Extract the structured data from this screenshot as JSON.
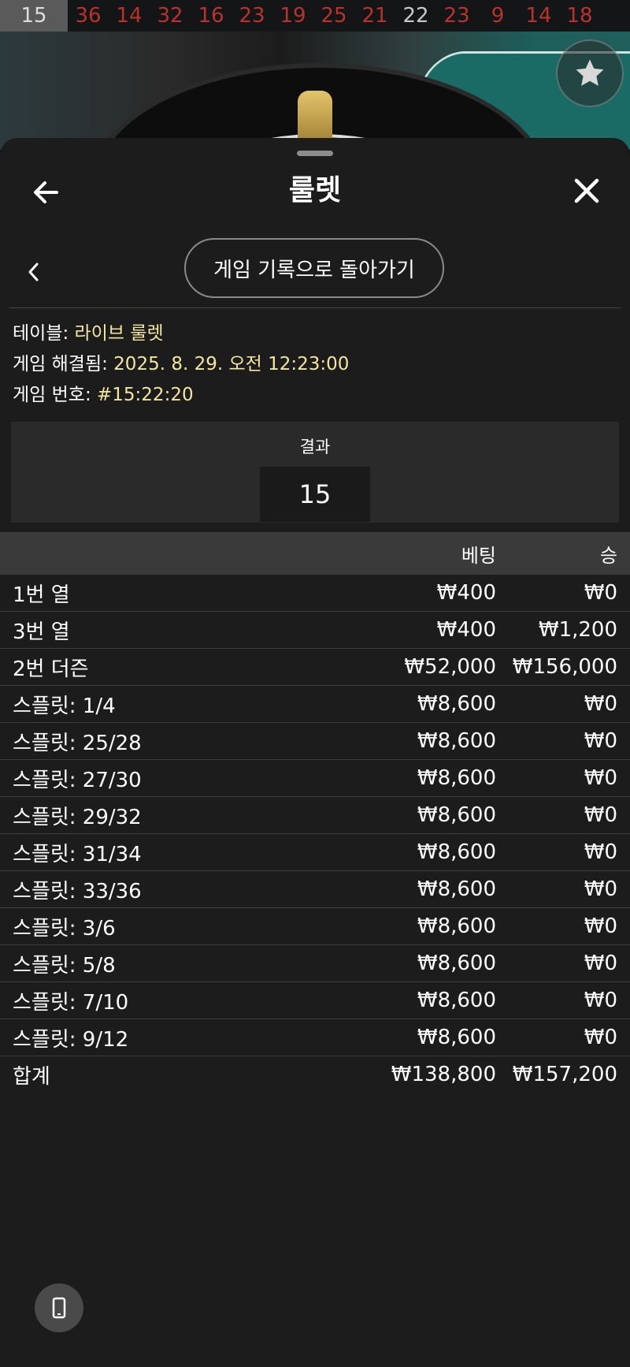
{
  "history": [
    {
      "value": "15",
      "color": "current"
    },
    {
      "value": "36",
      "color": "red"
    },
    {
      "value": "14",
      "color": "red"
    },
    {
      "value": "32",
      "color": "red"
    },
    {
      "value": "16",
      "color": "red"
    },
    {
      "value": "23",
      "color": "red"
    },
    {
      "value": "19",
      "color": "red"
    },
    {
      "value": "25",
      "color": "red"
    },
    {
      "value": "21",
      "color": "red"
    },
    {
      "value": "22",
      "color": "black"
    },
    {
      "value": "23",
      "color": "red"
    },
    {
      "value": "9",
      "color": "red"
    },
    {
      "value": "14",
      "color": "red"
    },
    {
      "value": "18",
      "color": "red"
    }
  ],
  "sheet": {
    "title": "룰렛",
    "back_to_history_label": "게임 기록으로 돌아가기"
  },
  "info": {
    "table_label": "테이블: ",
    "table_value": "라이브 룰렛",
    "resolved_label": "게임 해결됨: ",
    "resolved_value": "2025. 8. 29. 오전 12:23:00",
    "game_no_label": "게임 번호: ",
    "game_no_value": "#15:22:20"
  },
  "result": {
    "label": "결과",
    "value": "15"
  },
  "table": {
    "headers": {
      "bet": "베팅",
      "win": "승"
    },
    "rows": [
      {
        "name": "1번 열",
        "bet": "₩400",
        "win": "₩0"
      },
      {
        "name": "3번 열",
        "bet": "₩400",
        "win": "₩1,200"
      },
      {
        "name": "2번 더즌",
        "bet": "₩52,000",
        "win": "₩156,000"
      },
      {
        "name": "스플릿: 1/4",
        "bet": "₩8,600",
        "win": "₩0"
      },
      {
        "name": "스플릿: 25/28",
        "bet": "₩8,600",
        "win": "₩0"
      },
      {
        "name": "스플릿: 27/30",
        "bet": "₩8,600",
        "win": "₩0"
      },
      {
        "name": "스플릿: 29/32",
        "bet": "₩8,600",
        "win": "₩0"
      },
      {
        "name": "스플릿: 31/34",
        "bet": "₩8,600",
        "win": "₩0"
      },
      {
        "name": "스플릿: 33/36",
        "bet": "₩8,600",
        "win": "₩0"
      },
      {
        "name": "스플릿: 3/6",
        "bet": "₩8,600",
        "win": "₩0"
      },
      {
        "name": "스플릿: 5/8",
        "bet": "₩8,600",
        "win": "₩0"
      },
      {
        "name": "스플릿: 7/10",
        "bet": "₩8,600",
        "win": "₩0"
      },
      {
        "name": "스플릿: 9/12",
        "bet": "₩8,600",
        "win": "₩0"
      }
    ],
    "total": {
      "name": "합계",
      "bet": "₩138,800",
      "win": "₩157,200"
    }
  },
  "icons": {
    "back": "arrow-left-icon",
    "close": "close-icon",
    "chevron": "chevron-left-icon",
    "favorite": "star-icon",
    "device": "phone-icon"
  },
  "colors": {
    "accent_value": "#f2e6a0",
    "history_red": "#b8332c",
    "sheet_bg": "#1c1c1c"
  }
}
